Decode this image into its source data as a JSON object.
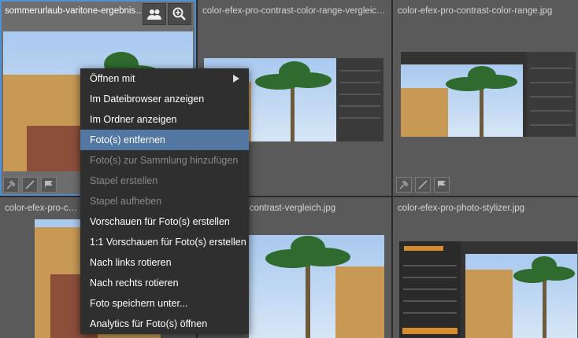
{
  "tiles": [
    {
      "title": "sommerurlaub-varitone-ergebnis.j..."
    },
    {
      "title": "color-efex-pro-contrast-color-range-vergleich.j..."
    },
    {
      "title": "color-efex-pro-contrast-color-range.jpg"
    },
    {
      "title": "color-efex-pro-contr"
    },
    {
      "title": "-contrast-vergleich.jpg"
    },
    {
      "title": "color-efex-pro-photo-stylizer.jpg"
    }
  ],
  "context_menu": {
    "items": [
      {
        "label": "Öffnen mit"
      },
      {
        "label": "Im Dateibrowser anzeigen"
      },
      {
        "label": "Im Ordner anzeigen"
      },
      {
        "label": "Foto(s) entfernen"
      },
      {
        "label": "Foto(s) zur Sammlung hinzufügen"
      },
      {
        "label": "Stapel erstellen"
      },
      {
        "label": "Stapel aufheben"
      },
      {
        "label": "Vorschauen für Foto(s) erstellen"
      },
      {
        "label": "1:1 Vorschauen für Foto(s) erstellen"
      },
      {
        "label": "Nach links rotieren"
      },
      {
        "label": "Nach rechts rotieren"
      },
      {
        "label": "Foto speichern unter..."
      },
      {
        "label": "Analytics für Foto(s) öffnen"
      }
    ]
  },
  "colors": {
    "accent": "#4f8fd6",
    "menu_highlight": "#5377a3",
    "menu_bg": "#2f2f2f"
  }
}
